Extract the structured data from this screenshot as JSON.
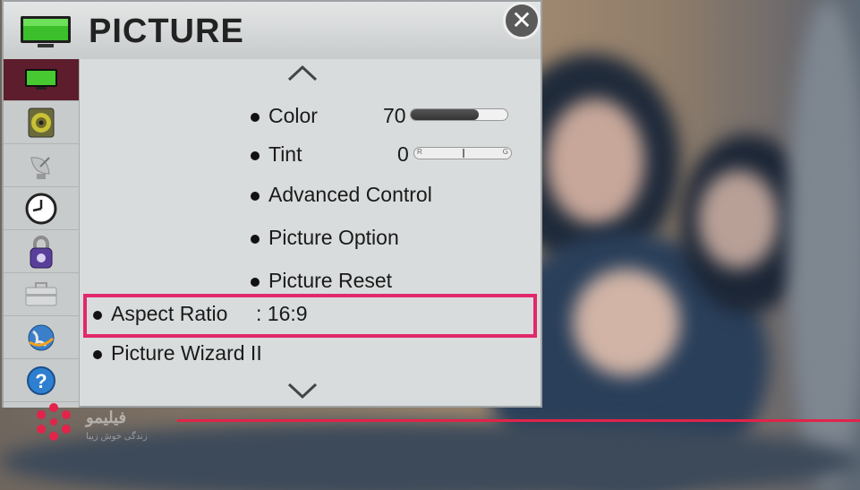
{
  "header": {
    "title": "PICTURE",
    "close_symbol": "✕"
  },
  "sidebar": {
    "items": [
      {
        "name": "picture",
        "icon": "tv-icon",
        "active": true
      },
      {
        "name": "audio",
        "icon": "speaker-icon",
        "active": false
      },
      {
        "name": "channel",
        "icon": "satellite-dish-icon",
        "active": false
      },
      {
        "name": "time",
        "icon": "clock-icon",
        "active": false
      },
      {
        "name": "lock",
        "icon": "padlock-icon",
        "active": false
      },
      {
        "name": "option",
        "icon": "toolbox-icon",
        "active": false
      },
      {
        "name": "network",
        "icon": "globe-icon",
        "active": false
      },
      {
        "name": "support",
        "icon": "question-icon",
        "active": false
      }
    ]
  },
  "menu": {
    "color": {
      "label": "Color",
      "value": "70",
      "level": 0.7
    },
    "tint": {
      "label": "Tint",
      "value": "0",
      "left_letter": "R",
      "right_letter": "G"
    },
    "advanced_control": {
      "label": "Advanced Control"
    },
    "picture_option": {
      "label": "Picture Option"
    },
    "picture_reset": {
      "label": "Picture Reset"
    },
    "aspect_ratio": {
      "label": "Aspect Ratio",
      "value": ": 16:9"
    },
    "picture_wizard": {
      "label": "Picture Wizard II"
    }
  },
  "colors": {
    "highlight": "#e2286c",
    "active_tab": "#5d1d2c",
    "accent_line": "#e2234a"
  },
  "watermark": {
    "name": "فیلیمو",
    "tagline": "زندگی خوش زیبا"
  }
}
